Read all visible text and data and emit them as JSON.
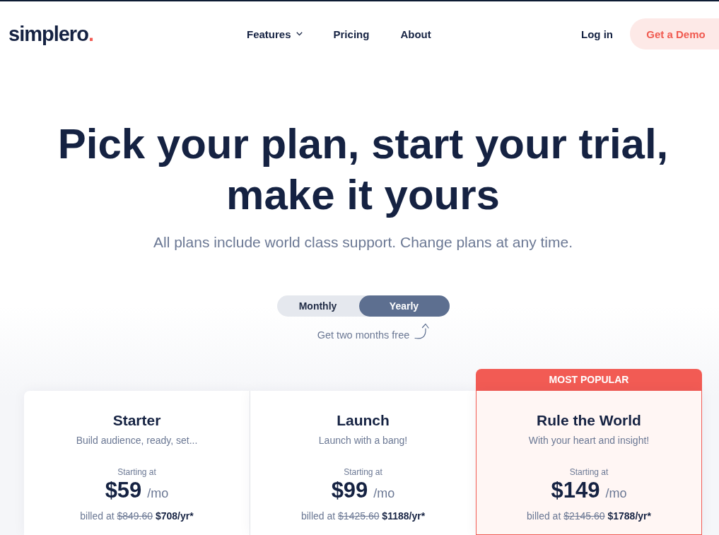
{
  "header": {
    "logo": {
      "name": "simplero",
      "dot": "."
    },
    "nav": [
      {
        "label": "Features",
        "has_menu": true
      },
      {
        "label": "Pricing",
        "has_menu": false
      },
      {
        "label": "About",
        "has_menu": false
      }
    ],
    "login": "Log in",
    "demo_button": "Get a Demo"
  },
  "hero": {
    "title_lines": [
      "Pick your plan, start your trial,",
      "make it yours"
    ],
    "subtitle": "All plans include world class support. Change plans at any time."
  },
  "billing": {
    "options": [
      {
        "label": "Monthly",
        "selected": false
      },
      {
        "label": "Yearly",
        "selected": true
      }
    ],
    "note": "Get two months free"
  },
  "plans": [
    {
      "name": "Starter",
      "tagline": "Build audience, ready, set...",
      "starting_label": "Starting at",
      "price": "$59",
      "period": "/mo",
      "billed_prefix": "billed at",
      "old_price": "$849.60",
      "new_price": "$708/yr*",
      "featured": false
    },
    {
      "name": "Launch",
      "tagline": "Launch with a bang!",
      "starting_label": "Starting at",
      "price": "$99",
      "period": "/mo",
      "billed_prefix": "billed at",
      "old_price": "$1425.60",
      "new_price": "$1188/yr*",
      "featured": false
    },
    {
      "name": "Rule the World",
      "tagline": "With your heart and insight!",
      "starting_label": "Starting at",
      "price": "$149",
      "period": "/mo",
      "billed_prefix": "billed at",
      "old_price": "$2145.60",
      "new_price": "$1788/yr*",
      "featured": true,
      "badge": "MOST POPULAR"
    }
  ]
}
